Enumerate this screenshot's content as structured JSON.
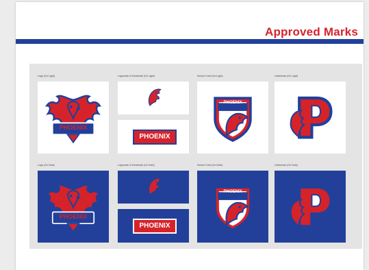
{
  "page": {
    "title": "Approved Marks"
  },
  "colors": {
    "brand_red": "#d6232a",
    "brand_blue": "#22409a",
    "panel_gray": "#e4e4e4"
  },
  "marks": {
    "labels": {
      "logo_light": "Logo (On Light)",
      "signature_light": "Logomark & Wordmark (On Light)",
      "shield_light": "School Crest (On Light)",
      "letter_light": "Lettermark (On Light)",
      "logo_dark": "Logo (On Dark)",
      "signature_dark": "Logomark & Wordmark (On Dark)",
      "shield_dark": "School Crest (On Dark)",
      "letter_dark": "Lettermark (On Dark)"
    },
    "wordmark": "PHOENIX",
    "crest_text": "PHOENIX",
    "letter": "P"
  }
}
